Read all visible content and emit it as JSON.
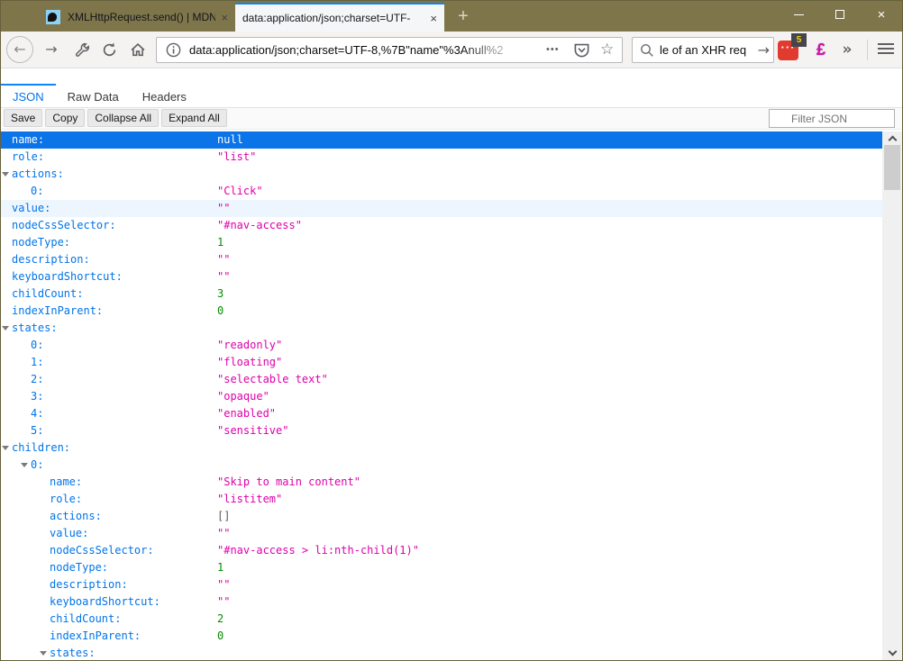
{
  "browser": {
    "tabs": [
      {
        "title": "XMLHttpRequest.send() | MDN",
        "close": "×",
        "active": false
      },
      {
        "title": "data:application/json;charset=UTF-",
        "close": "×",
        "active": true
      }
    ],
    "new_tab_label": "+",
    "window_controls": [
      "minimize",
      "maximize",
      "close"
    ]
  },
  "navbar": {
    "url": "data:application/json;charset=UTF-8,%7B\"name\"%3Anull%2",
    "overflow_dots": "•••",
    "bookmark_star": "☆",
    "search_text": "le of an XHR req",
    "search_go_arrow": "→",
    "back_arrow": "←",
    "forward_arrow": "→",
    "extension_red_dots": "···",
    "extension_badge": "5",
    "extension_pink_glyph": "£",
    "overflow_chevron": "»"
  },
  "json_viewer": {
    "tabs": [
      {
        "label": "JSON",
        "active": true
      },
      {
        "label": "Raw Data",
        "active": false
      },
      {
        "label": "Headers",
        "active": false
      }
    ],
    "toolbar_buttons": [
      "Save",
      "Copy",
      "Collapse All",
      "Expand All"
    ],
    "filter_placeholder": "Filter JSON",
    "colors": {
      "key": "#0074e8",
      "string": "#dd00a9",
      "number": "#058b00",
      "selected_bg": "#0a74e8",
      "hover_bg": "#edf6ff"
    },
    "rows": [
      {
        "key": "name",
        "value": "null",
        "type": "null",
        "level": 0,
        "expandable": false,
        "state": "selected"
      },
      {
        "key": "role",
        "value": "list",
        "type": "string",
        "level": 0
      },
      {
        "key": "actions",
        "type": "parent",
        "level": 0,
        "expandable": true
      },
      {
        "key": "0",
        "value": "Click",
        "type": "string",
        "level": 1
      },
      {
        "key": "value",
        "value": "",
        "type": "string",
        "level": 0,
        "state": "hover"
      },
      {
        "key": "nodeCssSelector",
        "value": "#nav-access",
        "type": "string",
        "level": 0
      },
      {
        "key": "nodeType",
        "value": "1",
        "type": "number",
        "level": 0
      },
      {
        "key": "description",
        "value": "",
        "type": "string",
        "level": 0
      },
      {
        "key": "keyboardShortcut",
        "value": "",
        "type": "string",
        "level": 0
      },
      {
        "key": "childCount",
        "value": "3",
        "type": "number",
        "level": 0
      },
      {
        "key": "indexInParent",
        "value": "0",
        "type": "number",
        "level": 0
      },
      {
        "key": "states",
        "type": "parent",
        "level": 0,
        "expandable": true
      },
      {
        "key": "0",
        "value": "readonly",
        "type": "string",
        "level": 1
      },
      {
        "key": "1",
        "value": "floating",
        "type": "string",
        "level": 1
      },
      {
        "key": "2",
        "value": "selectable text",
        "type": "string",
        "level": 1
      },
      {
        "key": "3",
        "value": "opaque",
        "type": "string",
        "level": 1
      },
      {
        "key": "4",
        "value": "enabled",
        "type": "string",
        "level": 1
      },
      {
        "key": "5",
        "value": "sensitive",
        "type": "string",
        "level": 1
      },
      {
        "key": "children",
        "type": "parent",
        "level": 0,
        "expandable": true
      },
      {
        "key": "0",
        "type": "parent",
        "level": 1,
        "expandable": true
      },
      {
        "key": "name",
        "value": "Skip to main content",
        "type": "string",
        "level": 2
      },
      {
        "key": "role",
        "value": "listitem",
        "type": "string",
        "level": 2
      },
      {
        "key": "actions",
        "value": "[]",
        "type": "bracket",
        "level": 2
      },
      {
        "key": "value",
        "value": "",
        "type": "string",
        "level": 2
      },
      {
        "key": "nodeCssSelector",
        "value": "#nav-access > li:nth-child(1)",
        "type": "string",
        "level": 2
      },
      {
        "key": "nodeType",
        "value": "1",
        "type": "number",
        "level": 2
      },
      {
        "key": "description",
        "value": "",
        "type": "string",
        "level": 2
      },
      {
        "key": "keyboardShortcut",
        "value": "",
        "type": "string",
        "level": 2
      },
      {
        "key": "childCount",
        "value": "2",
        "type": "number",
        "level": 2
      },
      {
        "key": "indexInParent",
        "value": "0",
        "type": "number",
        "level": 2
      },
      {
        "key": "states",
        "type": "parent",
        "level": 2,
        "expandable": true
      }
    ]
  }
}
